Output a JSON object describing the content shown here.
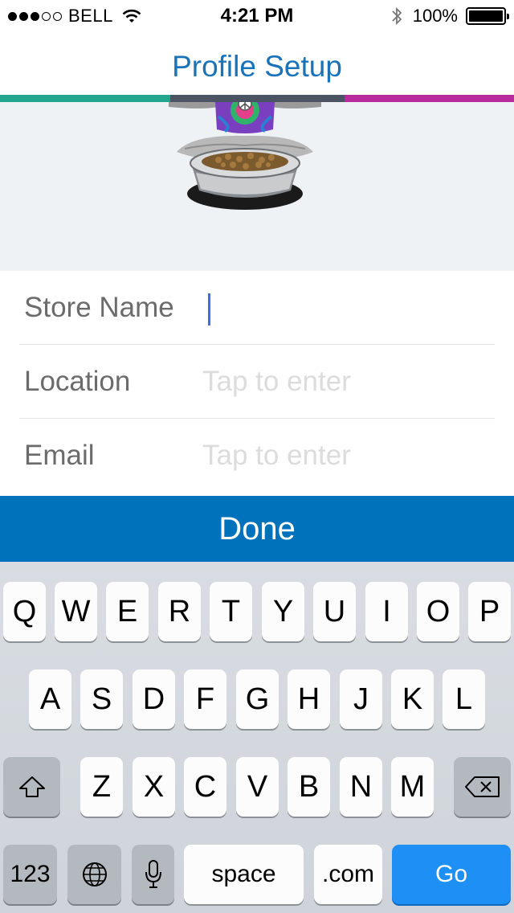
{
  "status_bar": {
    "carrier": "BELL",
    "signal_bars": 3,
    "signal_total": 5,
    "time": "4:21 PM",
    "battery": "100%",
    "icons": [
      "wifi-icon",
      "bluetooth-icon",
      "battery-icon"
    ]
  },
  "nav": {
    "title": "Profile Setup",
    "progress_colors": [
      "#22a68e",
      "#4a5462",
      "#b8299c"
    ]
  },
  "hero": {
    "image": "meditating-figure-with-pet-food-bowl"
  },
  "form": {
    "fields": [
      {
        "label": "Store Name",
        "value": "",
        "placeholder": ""
      },
      {
        "label": "Location",
        "value": "",
        "placeholder": "Tap to enter"
      },
      {
        "label": "Email",
        "value": "",
        "placeholder": "Tap to enter"
      }
    ]
  },
  "done_button": {
    "label": "Done",
    "color": "#0072bb"
  },
  "keyboard": {
    "row1": [
      "Q",
      "W",
      "E",
      "R",
      "T",
      "Y",
      "U",
      "I",
      "O",
      "P"
    ],
    "row2": [
      "A",
      "S",
      "D",
      "F",
      "G",
      "H",
      "J",
      "K",
      "L"
    ],
    "row3": [
      "Z",
      "X",
      "C",
      "V",
      "B",
      "N",
      "M"
    ],
    "shift_icon": "shift-icon",
    "delete_icon": "delete-icon",
    "globe_icon": "globe-icon",
    "mic_icon": "microphone-icon",
    "numbers_label": "123",
    "space_label": "space",
    "dotcom_label": ".com",
    "go_label": "Go",
    "go_color": "#1d8ff5"
  }
}
